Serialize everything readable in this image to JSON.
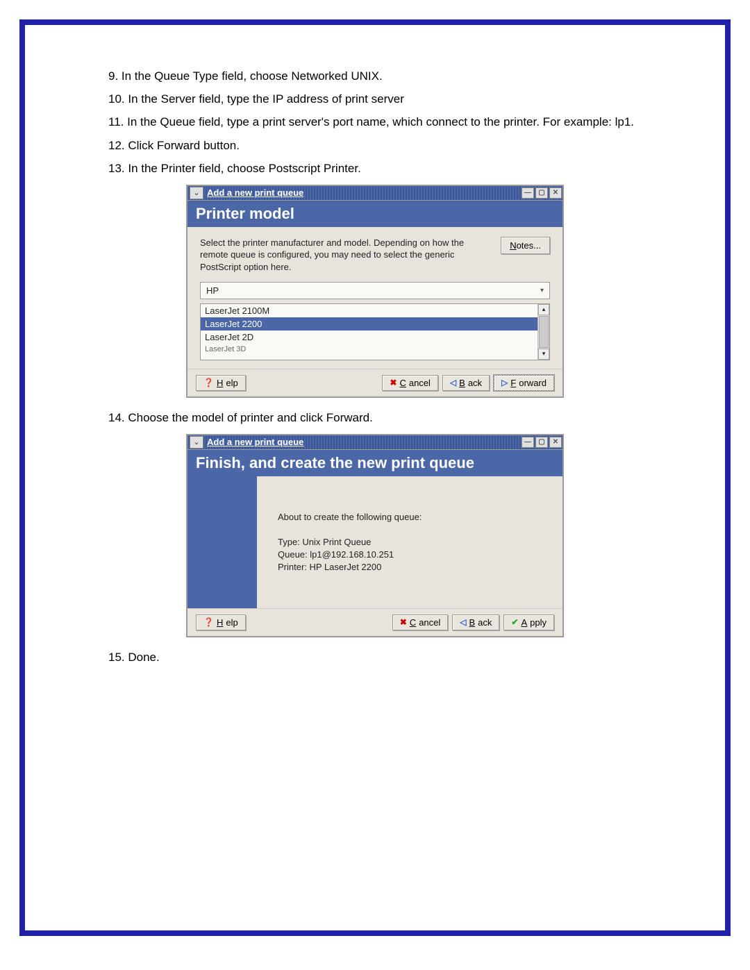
{
  "steps": {
    "s9": "9. In the Queue Type field, choose Networked UNIX.",
    "s10": "10. In the Server field, type the IP address of print server",
    "s11": "11. In the Queue field, type a print server's port name, which connect to the printer. For example: lp1.",
    "s12": "12. Click Forward button.",
    "s13": "13. In the Printer field, choose Postscript Printer.",
    "s14": "14. Choose the model of printer and click Forward.",
    "s15": "15. Done."
  },
  "dialog1": {
    "window_title": "Add a new print queue",
    "header": "Printer model",
    "description": "Select the printer manufacturer and model. Depending on how the remote queue is configured, you may need to select the generic PostScript option here.",
    "notes_label": "Notes...",
    "manufacturer": "HP",
    "models": {
      "m1": "LaserJet 2100M",
      "m2_selected": "LaserJet 2200",
      "m3": "LaserJet 2D",
      "m4_cut": "LaserJet 3D"
    },
    "buttons": {
      "help": "Help",
      "cancel": "Cancel",
      "back": "Back",
      "forward": "Forward"
    }
  },
  "dialog2": {
    "window_title": "Add a new print queue",
    "header": "Finish, and create the new print queue",
    "intro": "About to create the following queue:",
    "type_line": "Type: Unix Print Queue",
    "queue_line": "Queue: lp1@192.168.10.251",
    "printer_line": "Printer: HP LaserJet 2200",
    "buttons": {
      "help": "Help",
      "cancel": "Cancel",
      "back": "Back",
      "apply": "Apply"
    }
  }
}
